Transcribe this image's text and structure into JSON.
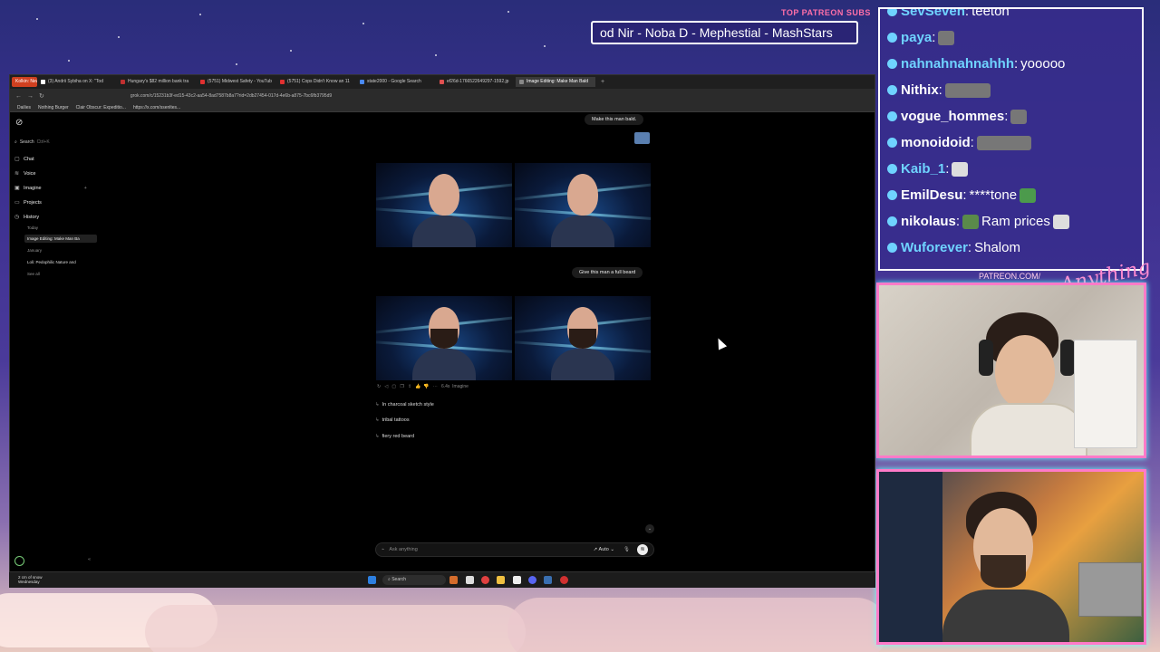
{
  "overlay": {
    "subs_title": "TOP PATREON SUBS",
    "subs_ticker": "od Nir - Noba D - Mephestial - MashStars",
    "patreon_label": "PATREON.COM/",
    "brand": "Anything Else"
  },
  "chat": [
    {
      "user": "SevSeven",
      "msg": "teeton",
      "color": "#6fd3ff"
    },
    {
      "user": "paya",
      "msg": "",
      "color": "#6fd3ff"
    },
    {
      "user": "nahnahnahnahhh",
      "msg": "yooooo",
      "color": "#6fd3ff"
    },
    {
      "user": "Nithix",
      "msg": "",
      "color": "#ffffff"
    },
    {
      "user": "vogue_hommes",
      "msg": "",
      "color": "#ffffff"
    },
    {
      "user": "monoidoid",
      "msg": "",
      "color": "#ffffff"
    },
    {
      "user": "Kaib_1",
      "msg": "",
      "color": "#6fd3ff"
    },
    {
      "user": "EmilDesu",
      "msg": "****tone",
      "color": "#ffffff"
    },
    {
      "user": "nikolaus",
      "msg": "Ram prices",
      "color": "#ffffff"
    },
    {
      "user": "Wuforever",
      "msg": "Shalom",
      "color": "#6fd3ff"
    }
  ],
  "browser": {
    "tabs": [
      {
        "label": "Kolkin: News",
        "color": "#d04020"
      },
      {
        "label": "(3) Andrii Sybiha on X: \"Tod",
        "color": "#ffffff"
      },
      {
        "label": "Hungary's $82 million bank tra",
        "color": "#c03030"
      },
      {
        "label": "(5751) Midwest Safety - YouTub",
        "color": "#e03030"
      },
      {
        "label": "(5751) Cops Didn't Know an 11",
        "color": "#e03030"
      },
      {
        "label": "state2000 - Google Search",
        "color": "#4a8af4"
      },
      {
        "label": "ef26d-1766522649297-1592.jp",
        "color": "#e05050"
      },
      {
        "label": "Image Editing: Make Man Bald",
        "color": "#888888"
      }
    ],
    "url": "grok.com/c/15231b3f-ed15-43c2-aa54-8ad7587b8a7?rid=2db27454-017d-4e6b-a875-7bc6fb3795d9",
    "bookmarks": [
      "Dailies",
      "Nothing Burger",
      "Clair Obscur: Expeditio...",
      "https://x.com/ssenltes..."
    ]
  },
  "sidebar": {
    "search_label": "Search",
    "search_shortcut": "Ctrl+K",
    "items": [
      {
        "label": "Chat",
        "icon": "chat-icon"
      },
      {
        "label": "Voice",
        "icon": "voice-icon"
      },
      {
        "label": "Imagine",
        "icon": "imagine-icon"
      },
      {
        "label": "Projects",
        "icon": "folder-icon"
      },
      {
        "label": "History",
        "icon": "history-icon"
      }
    ],
    "history": {
      "today_label": "Today",
      "today_item": "Image Editing: Make Man Ba",
      "january_label": "January",
      "january_item": "Loli: Pedophilic Nature and",
      "see_all": "See all"
    }
  },
  "conversation": {
    "prompt1": "Make this man bald.",
    "prompt2": "Give this man a full beard",
    "response_meta": "6.4s",
    "response_mode": "Imagine",
    "suggestions": [
      "In charcoal sketch style",
      "tribal tattoos",
      "fiery red beard"
    ],
    "input_placeholder": "Ask anything",
    "mode_label": "Auto"
  },
  "taskbar": {
    "weather_line1": "2 cm of snow",
    "weather_line2": "Wednesday",
    "search_label": "Search"
  }
}
